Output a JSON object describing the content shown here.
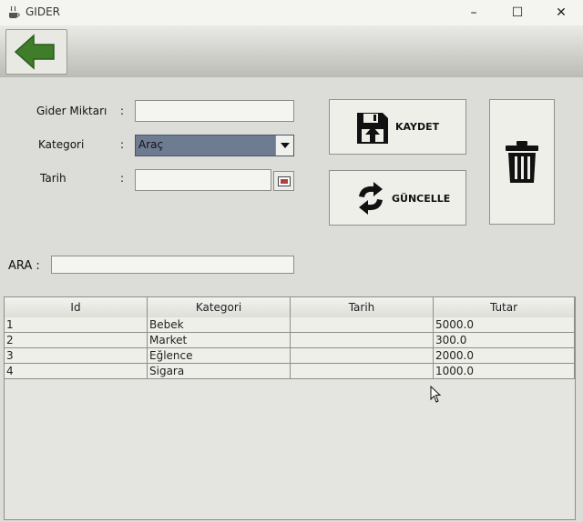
{
  "window": {
    "title": "GIDER",
    "minimize": "–",
    "maximize": "☐",
    "close": "✕"
  },
  "icons": {
    "back": "back-arrow-icon",
    "save": "floppy-disk-icon",
    "update": "refresh-icon",
    "delete": "trash-can-icon",
    "calendar": "calendar-icon"
  },
  "colors": {
    "back_arrow": "#3f7d2b",
    "select_bg": "#6e7c92"
  },
  "form": {
    "amount_label": "Gider Miktarı",
    "amount_value": "",
    "category_label": "Kategori",
    "category_value": "Araç",
    "date_label": "Tarih",
    "date_value": "",
    "colon": ":"
  },
  "buttons": {
    "save": "KAYDET",
    "update": "GÜNCELLE"
  },
  "search": {
    "label": "ARA :",
    "value": ""
  },
  "table": {
    "headers": [
      "Id",
      "Kategori",
      "Tarih",
      "Tutar"
    ],
    "rows": [
      [
        "1",
        "Bebek",
        "",
        "5000.0"
      ],
      [
        "2",
        "Market",
        "",
        "300.0"
      ],
      [
        "3",
        "Eğlence",
        "",
        "2000.0"
      ],
      [
        "4",
        "Sigara",
        "",
        "1000.0"
      ]
    ]
  }
}
